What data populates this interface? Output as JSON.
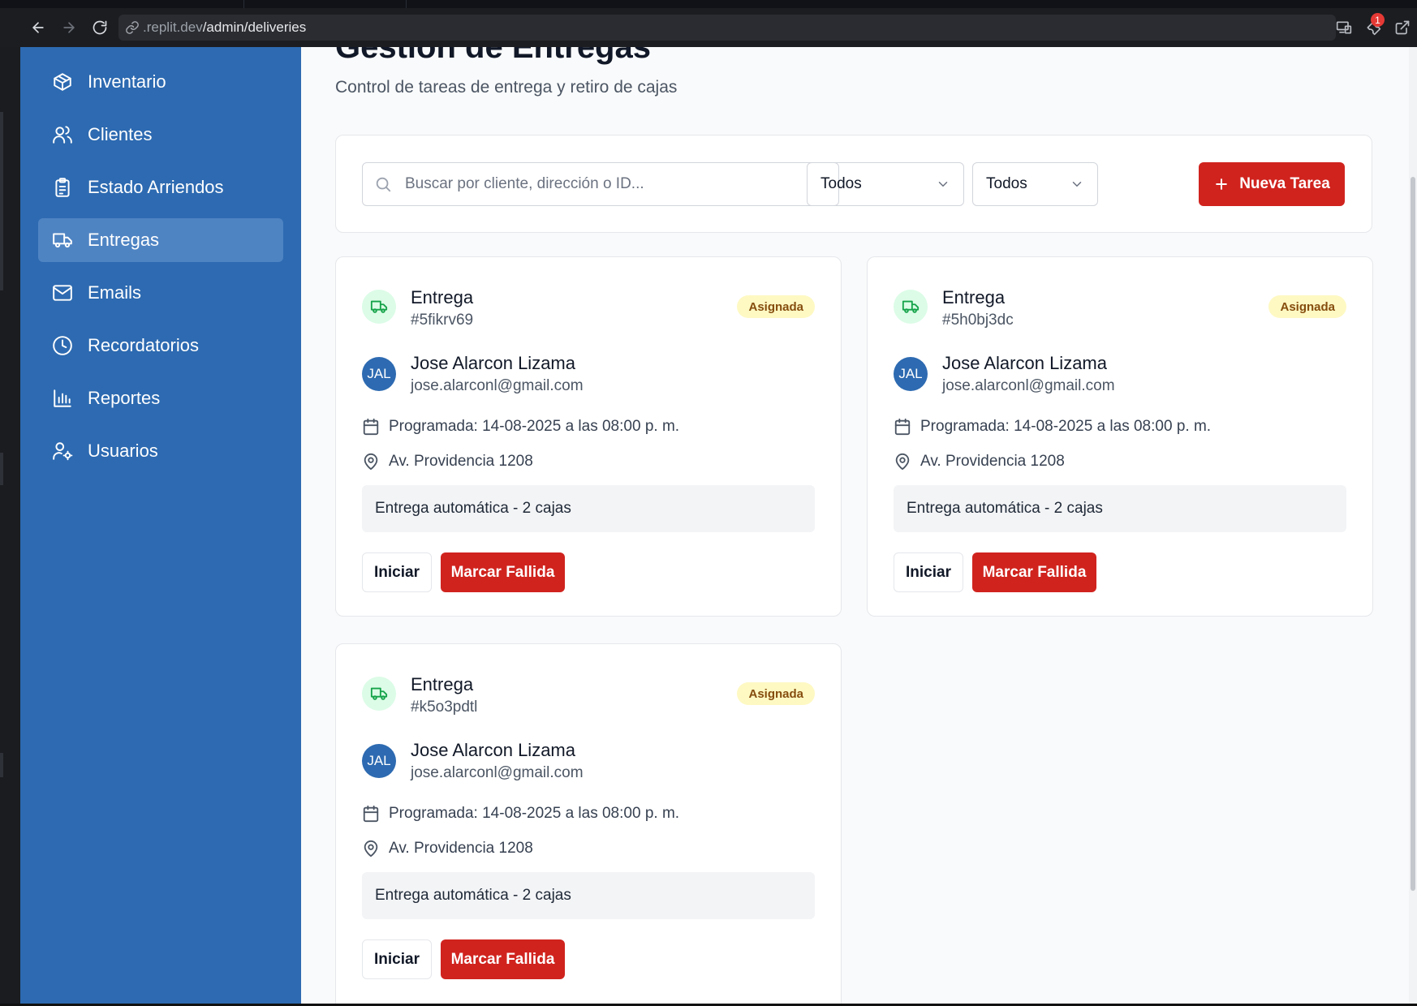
{
  "browser": {
    "url_host": ".replit.dev",
    "url_path": "/admin/deliveries",
    "notification_count": "1"
  },
  "sidebar": {
    "items": [
      {
        "label": "Inventario",
        "icon": "package-icon",
        "active": false
      },
      {
        "label": "Clientes",
        "icon": "users-icon",
        "active": false
      },
      {
        "label": "Estado Arriendos",
        "icon": "clipboard-list-icon",
        "active": false
      },
      {
        "label": "Entregas",
        "icon": "truck-icon",
        "active": true
      },
      {
        "label": "Emails",
        "icon": "mail-icon",
        "active": false
      },
      {
        "label": "Recordatorios",
        "icon": "clock-icon",
        "active": false
      },
      {
        "label": "Reportes",
        "icon": "bar-chart-icon",
        "active": false
      },
      {
        "label": "Usuarios",
        "icon": "user-cog-icon",
        "active": false
      }
    ]
  },
  "page": {
    "title": "Gestión de Entregas",
    "subtitle": "Control de tareas de entrega y retiro de cajas"
  },
  "filters": {
    "search_placeholder": "Buscar por cliente, dirección o ID...",
    "type_select": "Todos",
    "status_select": "Todos",
    "new_task_label": "Nueva Tarea"
  },
  "tasks": [
    {
      "type": "Entrega",
      "id": "#5fikrv69",
      "status": "Asignada",
      "initials": "JAL",
      "client_name": "Jose Alarcon Lizama",
      "client_email": "jose.alarconl@gmail.com",
      "scheduled": "Programada: 14-08-2025 a las 08:00 p. m.",
      "address": "Av. Providencia 1208",
      "note": "Entrega automática - 2 cajas",
      "start_label": "Iniciar",
      "fail_label": "Marcar Fallida"
    },
    {
      "type": "Entrega",
      "id": "#5h0bj3dc",
      "status": "Asignada",
      "initials": "JAL",
      "client_name": "Jose Alarcon Lizama",
      "client_email": "jose.alarconl@gmail.com",
      "scheduled": "Programada: 14-08-2025 a las 08:00 p. m.",
      "address": "Av. Providencia 1208",
      "note": "Entrega automática - 2 cajas",
      "start_label": "Iniciar",
      "fail_label": "Marcar Fallida"
    },
    {
      "type": "Entrega",
      "id": "#k5o3pdtl",
      "status": "Asignada",
      "initials": "JAL",
      "client_name": "Jose Alarcon Lizama",
      "client_email": "jose.alarconl@gmail.com",
      "scheduled": "Programada: 14-08-2025 a las 08:00 p. m.",
      "address": "Av. Providencia 1208",
      "note": "Entrega automática - 2 cajas",
      "start_label": "Iniciar",
      "fail_label": "Marcar Fallida"
    }
  ],
  "colors": {
    "sidebar_bg": "#2d6ab1",
    "sidebar_active": "#4f84c3",
    "primary_red": "#d0231e",
    "status_badge_bg": "#fef9c3",
    "status_badge_text": "#854d0e",
    "truck_icon_bg": "#dcfce7",
    "truck_icon": "#16a34a"
  }
}
